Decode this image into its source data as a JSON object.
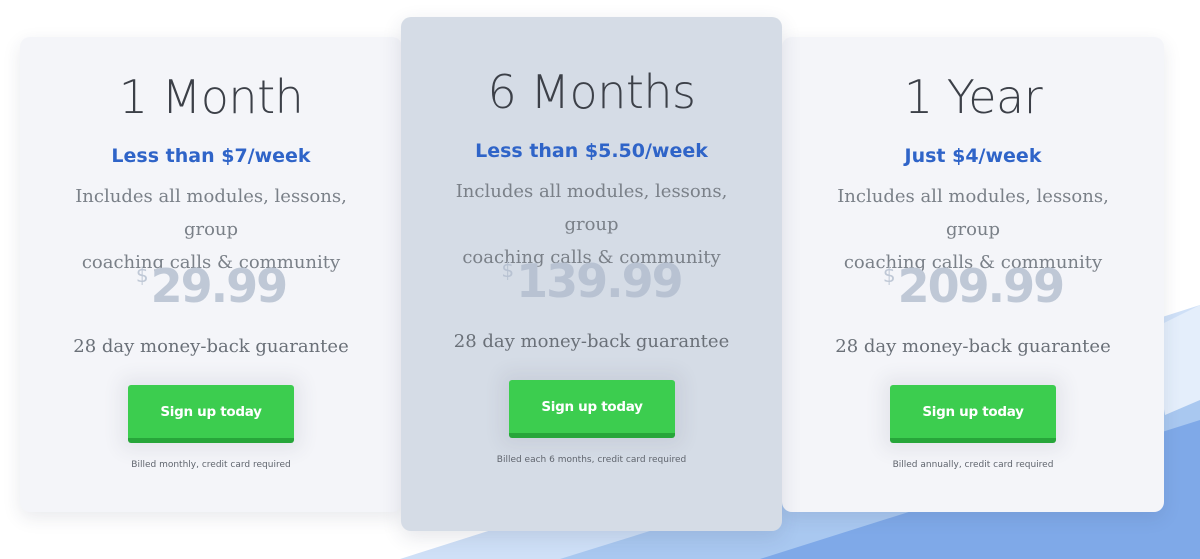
{
  "plans": [
    {
      "title": "1 Month",
      "per_week": "Less than $7/week",
      "desc_line1": "Includes all modules, lessons, group",
      "desc_line2": "coaching calls & community",
      "currency": "$",
      "price": "29.99",
      "guarantee": "28 day money-back guarantee",
      "button_label": "Sign up today",
      "billing_note": "Billed monthly, credit card required"
    },
    {
      "title": "6 Months",
      "per_week": "Less than $5.50/week",
      "desc_line1": "Includes all modules, lessons, group",
      "desc_line2": "coaching calls & community",
      "currency": "$",
      "price": "139.99",
      "guarantee": "28 day money-back guarantee",
      "button_label": "Sign up today",
      "billing_note": "Billed each 6 months, credit card required"
    },
    {
      "title": "1 Year",
      "per_week": "Just $4/week",
      "desc_line1": "Includes all modules, lessons, group",
      "desc_line2": "coaching calls & community",
      "currency": "$",
      "price": "209.99",
      "guarantee": "28 day money-back guarantee",
      "button_label": "Sign up today",
      "billing_note": "Billed annually, credit card required"
    }
  ],
  "colors": {
    "accent_blue": "#2f64c8",
    "button_green": "#3ccd4f",
    "price_grey": "#bfc8d6",
    "featured_card_bg": "#d5dce6",
    "card_bg": "#f4f5f9"
  }
}
